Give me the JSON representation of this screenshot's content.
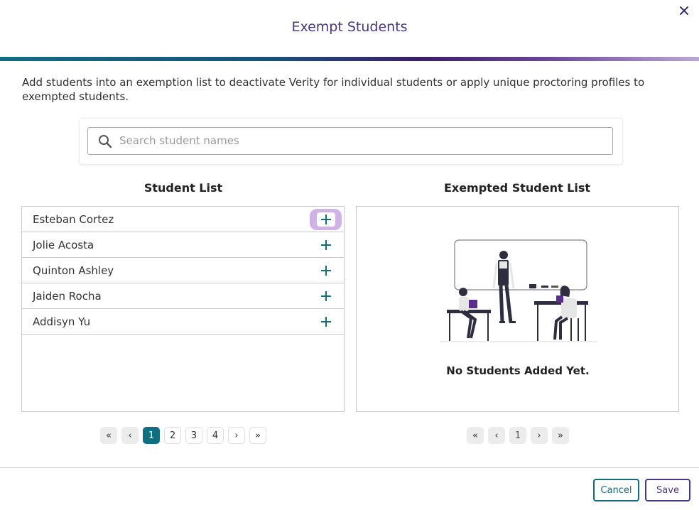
{
  "dialog": {
    "title": "Exempt Students"
  },
  "description": "Add students into an exemption list to deactivate Verity for individual students or apply unique proctoring profiles to exempted students.",
  "search": {
    "placeholder": "Search student names",
    "value": ""
  },
  "student_list": {
    "title": "Student List",
    "students": [
      {
        "name": "Esteban Cortez"
      },
      {
        "name": "Jolie Acosta"
      },
      {
        "name": "Quinton Ashley"
      },
      {
        "name": "Jaiden Rocha"
      },
      {
        "name": "Addisyn Yu"
      }
    ],
    "pagination": {
      "first": "«",
      "prev": "‹",
      "pages": [
        "1",
        "2",
        "3",
        "4"
      ],
      "current": "1",
      "next": "›",
      "last": "»"
    }
  },
  "exempted_list": {
    "title": "Exempted Student List",
    "empty_message": "No Students Added Yet.",
    "pagination": {
      "first": "«",
      "prev": "‹",
      "page": "1",
      "next": "›",
      "last": "»"
    }
  },
  "footer": {
    "cancel_label": "Cancel",
    "save_label": "Save"
  },
  "icons": {
    "close": "close-icon",
    "search": "search-icon",
    "add": "plus-icon"
  },
  "colors": {
    "accent_teal": "#0f6e80",
    "accent_purple": "#4a3780",
    "focus_ring": "#cfb3e6"
  }
}
